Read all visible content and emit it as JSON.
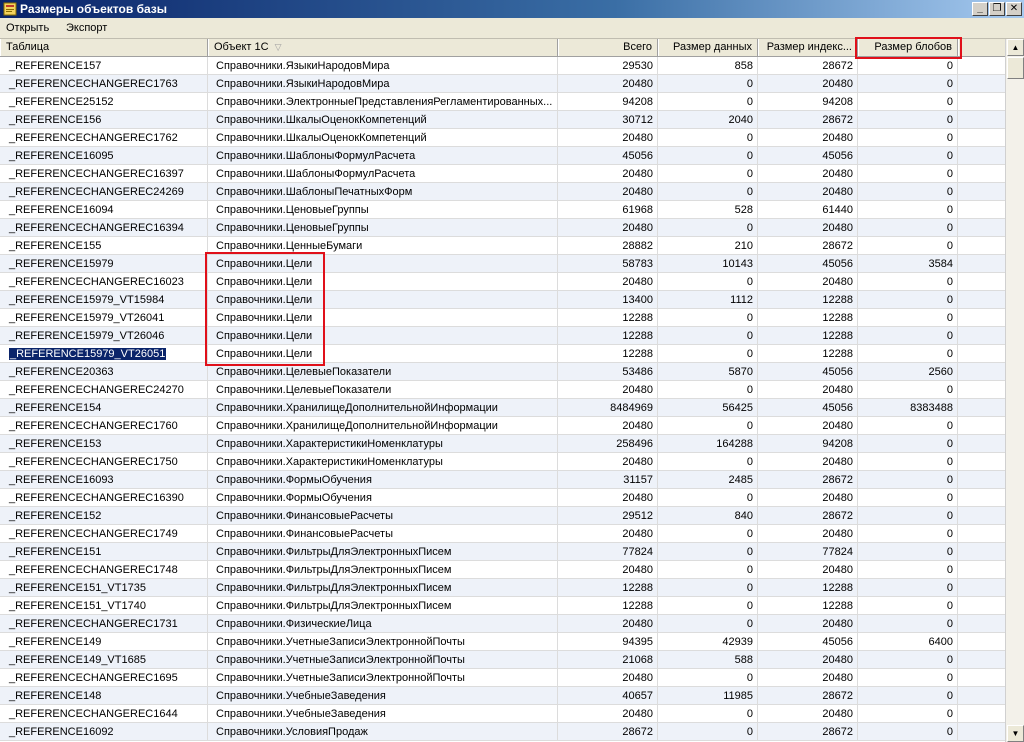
{
  "window": {
    "title": "Размеры объектов базы",
    "minimize": "_",
    "restore": "❐",
    "close": "✕"
  },
  "menu": [
    "Открыть",
    "Экспорт"
  ],
  "columns": [
    "Таблица",
    "Объект 1С",
    "Всего",
    "Размер данных",
    "Размер индекс...",
    "Размер блобов"
  ],
  "sort_icon": "▽",
  "scrollbar": {
    "up": "▲",
    "down": "▼"
  },
  "rows": [
    [
      "_REFERENCE157",
      "Справочники.ЯзыкиНародовМира",
      "29530",
      "858",
      "28672",
      "0"
    ],
    [
      "_REFERENCECHANGEREC1763",
      "Справочники.ЯзыкиНародовМира",
      "20480",
      "0",
      "20480",
      "0"
    ],
    [
      "_REFERENCE25152",
      "Справочники.ЭлектронныеПредставленияРегламентированных...",
      "94208",
      "0",
      "94208",
      "0"
    ],
    [
      "_REFERENCE156",
      "Справочники.ШкалыОценокКомпетенций",
      "30712",
      "2040",
      "28672",
      "0"
    ],
    [
      "_REFERENCECHANGEREC1762",
      "Справочники.ШкалыОценокКомпетенций",
      "20480",
      "0",
      "20480",
      "0"
    ],
    [
      "_REFERENCE16095",
      "Справочники.ШаблоныФормулРасчета",
      "45056",
      "0",
      "45056",
      "0"
    ],
    [
      "_REFERENCECHANGEREC16397",
      "Справочники.ШаблоныФормулРасчета",
      "20480",
      "0",
      "20480",
      "0"
    ],
    [
      "_REFERENCECHANGEREC24269",
      "Справочники.ШаблоныПечатныхФорм",
      "20480",
      "0",
      "20480",
      "0"
    ],
    [
      "_REFERENCE16094",
      "Справочники.ЦеновыеГруппы",
      "61968",
      "528",
      "61440",
      "0"
    ],
    [
      "_REFERENCECHANGEREC16394",
      "Справочники.ЦеновыеГруппы",
      "20480",
      "0",
      "20480",
      "0"
    ],
    [
      "_REFERENCE155",
      "Справочники.ЦенныеБумаги",
      "28882",
      "210",
      "28672",
      "0"
    ],
    [
      "_REFERENCE15979",
      "Справочники.Цели",
      "58783",
      "10143",
      "45056",
      "3584"
    ],
    [
      "_REFERENCECHANGEREC16023",
      "Справочники.Цели",
      "20480",
      "0",
      "20480",
      "0"
    ],
    [
      "_REFERENCE15979_VT15984",
      "Справочники.Цели",
      "13400",
      "1112",
      "12288",
      "0"
    ],
    [
      "_REFERENCE15979_VT26041",
      "Справочники.Цели",
      "12288",
      "0",
      "12288",
      "0"
    ],
    [
      "_REFERENCE15979_VT26046",
      "Справочники.Цели",
      "12288",
      "0",
      "12288",
      "0"
    ],
    [
      "_REFERENCE15979_VT26051",
      "Справочники.Цели",
      "12288",
      "0",
      "12288",
      "0"
    ],
    [
      "_REFERENCE20363",
      "Справочники.ЦелевыеПоказатели",
      "53486",
      "5870",
      "45056",
      "2560"
    ],
    [
      "_REFERENCECHANGEREC24270",
      "Справочники.ЦелевыеПоказатели",
      "20480",
      "0",
      "20480",
      "0"
    ],
    [
      "_REFERENCE154",
      "Справочники.ХранилищеДополнительнойИнформации",
      "8484969",
      "56425",
      "45056",
      "8383488"
    ],
    [
      "_REFERENCECHANGEREC1760",
      "Справочники.ХранилищеДополнительнойИнформации",
      "20480",
      "0",
      "20480",
      "0"
    ],
    [
      "_REFERENCE153",
      "Справочники.ХарактеристикиНоменклатуры",
      "258496",
      "164288",
      "94208",
      "0"
    ],
    [
      "_REFERENCECHANGEREC1750",
      "Справочники.ХарактеристикиНоменклатуры",
      "20480",
      "0",
      "20480",
      "0"
    ],
    [
      "_REFERENCE16093",
      "Справочники.ФормыОбучения",
      "31157",
      "2485",
      "28672",
      "0"
    ],
    [
      "_REFERENCECHANGEREC16390",
      "Справочники.ФормыОбучения",
      "20480",
      "0",
      "20480",
      "0"
    ],
    [
      "_REFERENCE152",
      "Справочники.ФинансовыеРасчеты",
      "29512",
      "840",
      "28672",
      "0"
    ],
    [
      "_REFERENCECHANGEREC1749",
      "Справочники.ФинансовыеРасчеты",
      "20480",
      "0",
      "20480",
      "0"
    ],
    [
      "_REFERENCE151",
      "Справочники.ФильтрыДляЭлектронныхПисем",
      "77824",
      "0",
      "77824",
      "0"
    ],
    [
      "_REFERENCECHANGEREC1748",
      "Справочники.ФильтрыДляЭлектронныхПисем",
      "20480",
      "0",
      "20480",
      "0"
    ],
    [
      "_REFERENCE151_VT1735",
      "Справочники.ФильтрыДляЭлектронныхПисем",
      "12288",
      "0",
      "12288",
      "0"
    ],
    [
      "_REFERENCE151_VT1740",
      "Справочники.ФильтрыДляЭлектронныхПисем",
      "12288",
      "0",
      "12288",
      "0"
    ],
    [
      "_REFERENCECHANGEREC1731",
      "Справочники.ФизическиеЛица",
      "20480",
      "0",
      "20480",
      "0"
    ],
    [
      "_REFERENCE149",
      "Справочники.УчетныеЗаписиЭлектроннойПочты",
      "94395",
      "42939",
      "45056",
      "6400"
    ],
    [
      "_REFERENCE149_VT1685",
      "Справочники.УчетныеЗаписиЭлектроннойПочты",
      "21068",
      "588",
      "20480",
      "0"
    ],
    [
      "_REFERENCECHANGEREC1695",
      "Справочники.УчетныеЗаписиЭлектроннойПочты",
      "20480",
      "0",
      "20480",
      "0"
    ],
    [
      "_REFERENCE148",
      "Справочники.УчебныеЗаведения",
      "40657",
      "11985",
      "28672",
      "0"
    ],
    [
      "_REFERENCECHANGEREC1644",
      "Справочники.УчебныеЗаведения",
      "20480",
      "0",
      "20480",
      "0"
    ],
    [
      "_REFERENCE16092",
      "Справочники.УсловияПродаж",
      "28672",
      "0",
      "28672",
      "0"
    ]
  ],
  "selected_row": 16
}
